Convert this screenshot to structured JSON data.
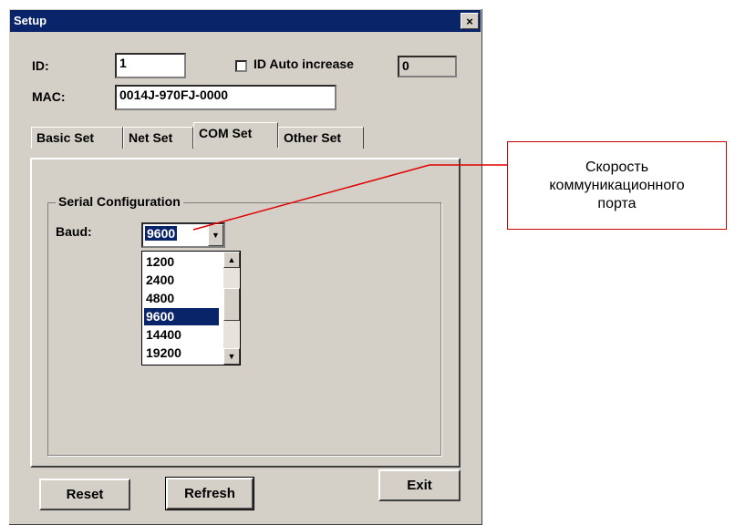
{
  "window": {
    "title": "Setup",
    "close_glyph": "×"
  },
  "header": {
    "id_label": "ID:",
    "id_value": "1",
    "auto_increase_label": "ID Auto increase",
    "auto_increase_checked": false,
    "auto_increase_value": "0",
    "mac_label": "MAC:",
    "mac_value": "0014J-970FJ-0000"
  },
  "tabs": [
    "Basic Set",
    "Net Set",
    "COM Set",
    "Other Set"
  ],
  "active_tab": "COM Set",
  "serial": {
    "group_title": "Serial Configuration",
    "baud_label": "Baud:",
    "baud_value": "9600",
    "options": [
      "1200",
      "2400",
      "4800",
      "9600",
      "14400",
      "19200"
    ],
    "selected_option": "9600"
  },
  "buttons": {
    "reset": "Reset",
    "refresh": "Refresh",
    "exit": "Exit"
  },
  "annotation": {
    "text": "Скорость\nкоммуникационного\nпорта",
    "line_color": "#e00000"
  },
  "icons": {
    "close": "close-icon",
    "dropdown": "chevron-down-icon",
    "scroll_up": "scroll-up-arrow-icon",
    "scroll_down": "scroll-down-arrow-icon"
  }
}
